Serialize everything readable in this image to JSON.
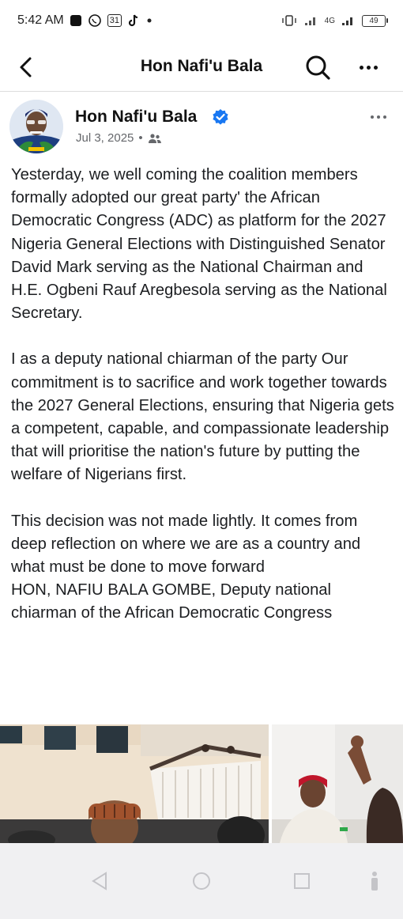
{
  "status_bar": {
    "time": "5:42 AM",
    "network": "4G",
    "battery": "49",
    "icons": [
      "notification-square-icon",
      "whatsapp-icon",
      "calendar-icon",
      "tiktok-icon",
      "dot-icon",
      "vibrate-icon",
      "signal-icon",
      "battery-icon"
    ],
    "calendar_day": "31"
  },
  "header": {
    "title": "Hon Nafi'u Bala",
    "icons": [
      "back-arrow-icon",
      "search-icon",
      "more-icon"
    ]
  },
  "post": {
    "author": "Hon Nafi'u Bala",
    "date": "Jul 3, 2025",
    "separator": "•",
    "audience_icon": "friends-icon",
    "verified_color": "#1877f2",
    "paragraphs": [
      "Yesterday,  we well coming  the coalition members formally adopted our great party' the African Democratic Congress (ADC) as platform for the 2027 Nigeria General Elections with Distinguished Senator David Mark serving as the National Chairman and H.E. Ogbeni Rauf Aregbesola serving as the National Secretary.",
      "I as a deputy national chiarman of the party Our commitment is to sacrifice and work together towards the 2027 General Elections, ensuring that Nigeria gets a competent, capable, and compassionate leadership that will prioritise the nation's future by putting the welfare of Nigerians first.",
      "This decision was not made lightly. It comes from deep reflection on where we are as a country and what must be done to move forward\nHON, NAFIU BALA GOMBE, Deputy national chiarman of the African Democratic Congress"
    ],
    "photos": [
      "post-photo-1",
      "post-photo-2"
    ]
  },
  "nav_bar": {
    "icons": [
      "back-triangle-icon",
      "home-circle-icon",
      "recents-square-icon",
      "accessibility-icon"
    ]
  }
}
